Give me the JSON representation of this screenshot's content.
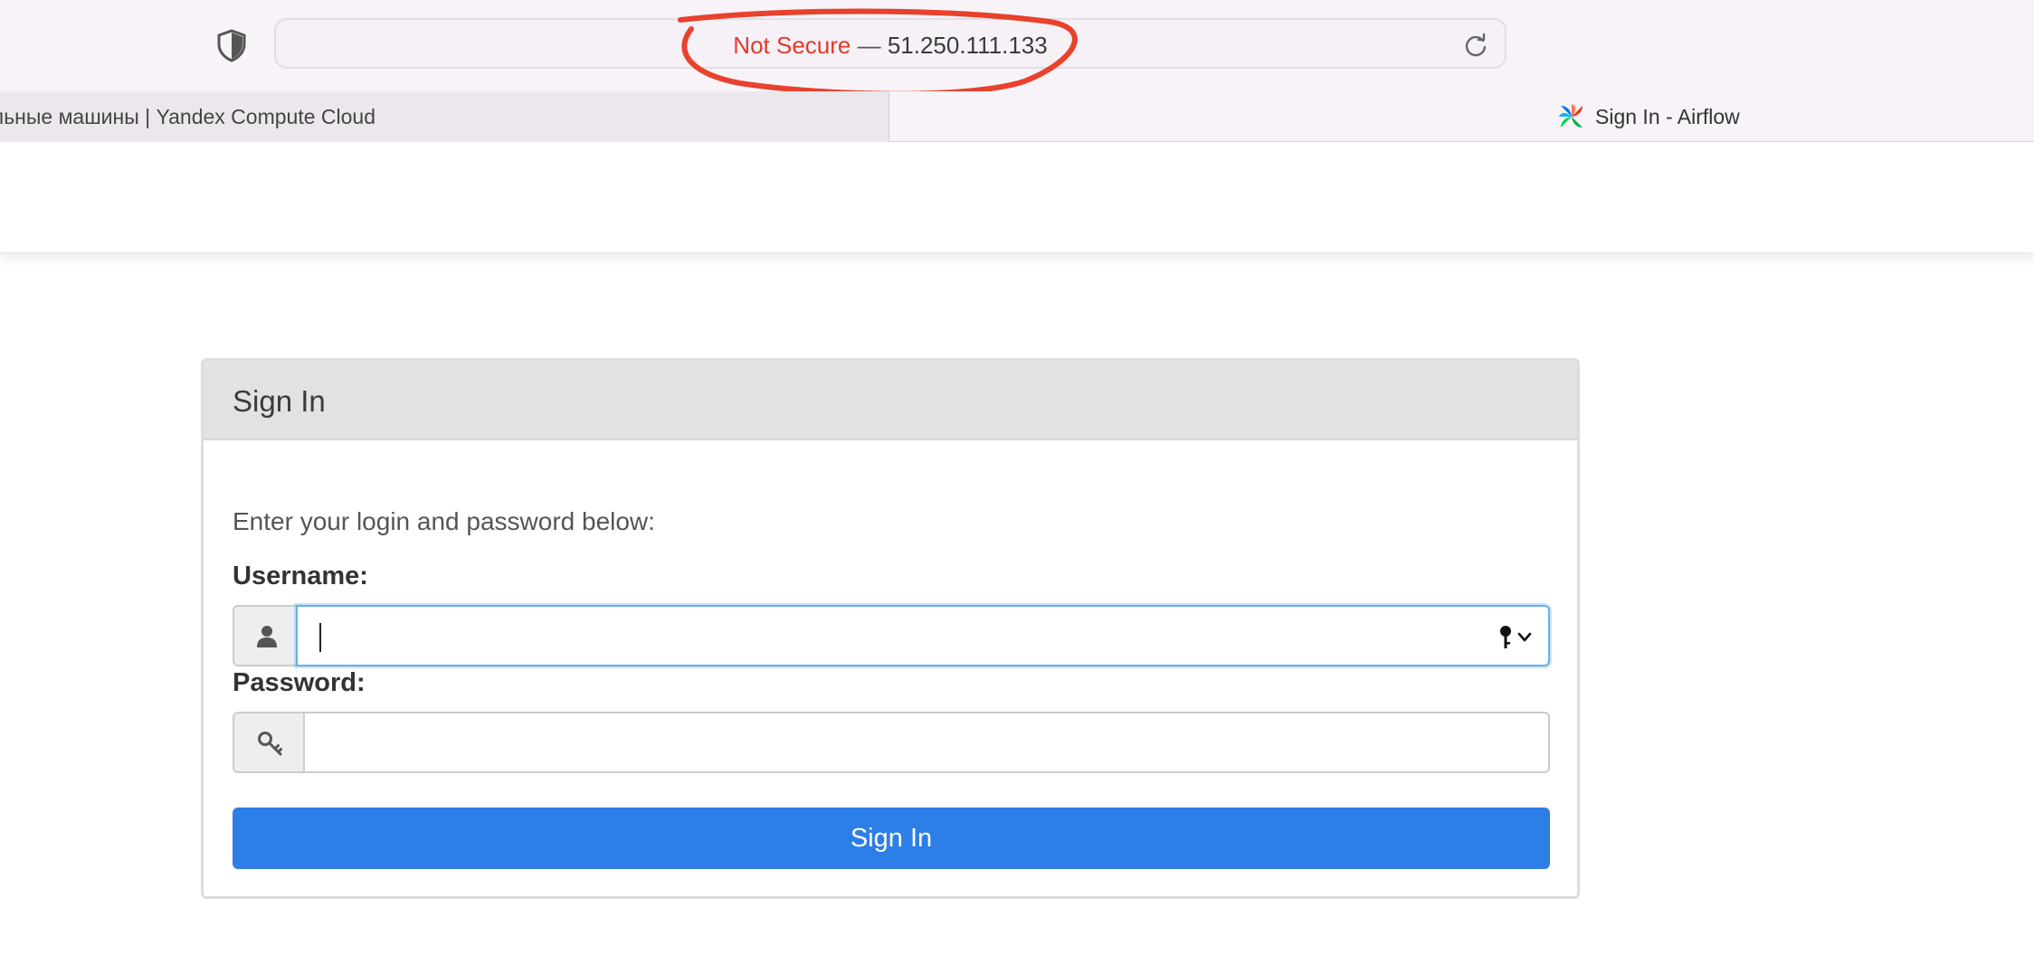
{
  "browser": {
    "url_security": "Not Secure",
    "url_separator": " — ",
    "url_host": "51.250.111.133",
    "annotation_color": "#e8412c",
    "tabs": [
      {
        "label": "льные машины | Yandex Compute Cloud",
        "active": false
      },
      {
        "label": "Sign In - Airflow",
        "active": true,
        "icon": "airflow-pinwheel-icon"
      }
    ]
  },
  "login": {
    "title": "Sign In",
    "intro": "Enter your login and password below:",
    "username_label": "Username:",
    "username_value": "",
    "password_label": "Password:",
    "password_value": "",
    "submit_label": "Sign In",
    "accent_color": "#2d7ee6"
  }
}
